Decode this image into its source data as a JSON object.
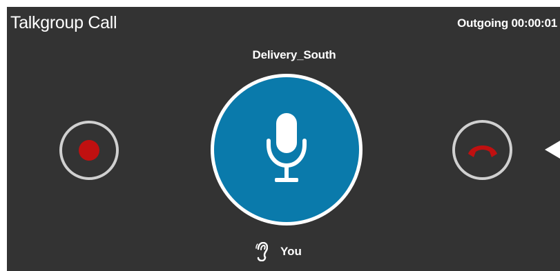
{
  "header": {
    "title": "Talkgroup Call",
    "status": "Outgoing 00:00:01"
  },
  "call": {
    "group_name": "Delivery_South",
    "speaker": "You"
  },
  "icons": {
    "record": "record-icon",
    "ptt": "microphone-icon",
    "hangup": "phone-hangup-icon",
    "expand": "caret-left-icon",
    "speaker": "ear-icon"
  },
  "colors": {
    "panel_bg": "#333333",
    "ptt_blue": "#0a7aab",
    "record_red": "#c01010",
    "hangup_red": "#c01010",
    "ring_gray": "#d0d0d0"
  }
}
